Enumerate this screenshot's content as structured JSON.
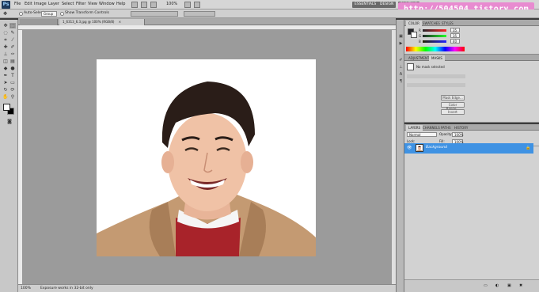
{
  "app": {
    "logo": "Ps"
  },
  "menu": {
    "items": [
      "File",
      "Edit",
      "Image",
      "Layer",
      "Select",
      "Filter",
      "View",
      "Window",
      "Help"
    ],
    "zoom": "100%",
    "workspaces": [
      "ESSENTIALS",
      "DESIGN",
      "PAINTING",
      "»"
    ]
  },
  "watermark": "http://504504.tistory.com",
  "options": {
    "auto_select_label": "Auto-Select:",
    "auto_select_value": "Group",
    "transform_label": "Show Transform Controls"
  },
  "document": {
    "tab_title": "1_6313_6.3.jpg @ 100% (RGB/8)",
    "tab_close": "×"
  },
  "status": {
    "zoom": "100%",
    "info": "Exposure works in 32-bit only"
  },
  "panels": {
    "color": {
      "tabs": [
        "COLOR",
        "SWATCHES",
        "STYLES"
      ],
      "r_value": "35",
      "g_value": "35",
      "b_value": "40"
    },
    "adjust": {
      "tabs": [
        "ADJUSTMENTS",
        "MASKS"
      ],
      "mask_label": "No mask selected",
      "buttons": [
        "Mask Edge...",
        "Color Range...",
        "Invert"
      ]
    },
    "layers": {
      "tabs": [
        "LAYERS",
        "CHANNELS",
        "PATHS",
        "HISTORY"
      ],
      "blend_mode": "Normal",
      "opacity_label": "Opacity:",
      "opacity_value": "100%",
      "lock_label": "Lock:",
      "fill_label": "Fill:",
      "fill_value": "100%",
      "layer_name": "Background"
    }
  },
  "icons": {
    "eye": "👁",
    "lock": "🔒",
    "close": "×"
  }
}
